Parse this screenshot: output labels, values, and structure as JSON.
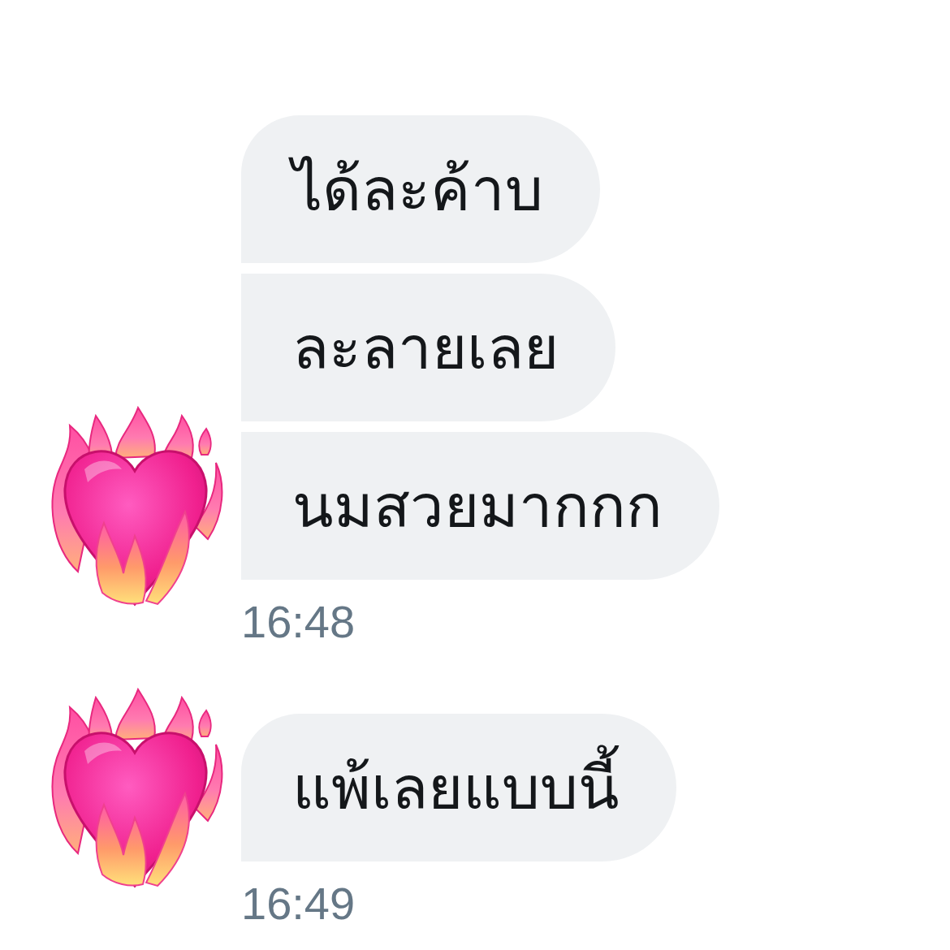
{
  "conversation": {
    "groups": [
      {
        "bubbles": [
          {
            "text": "ได้ละค้าบ"
          },
          {
            "text": "ละลายเลย"
          },
          {
            "text": "นมสวยมากกก"
          }
        ],
        "time": "16:48"
      },
      {
        "bubbles": [
          {
            "text": "แพ้เลยแบบนี้"
          }
        ],
        "time": "16:49"
      }
    ]
  }
}
